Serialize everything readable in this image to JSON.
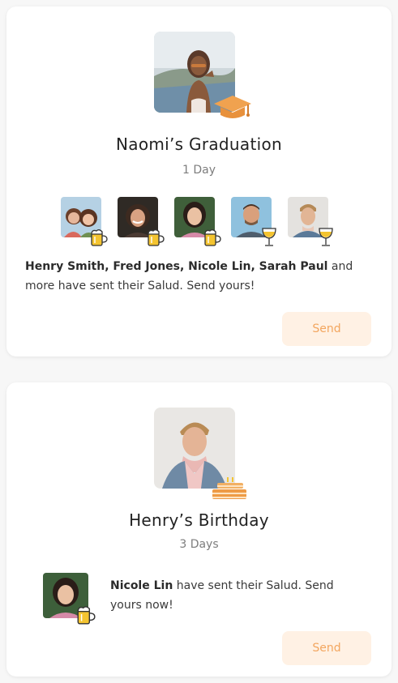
{
  "events": [
    {
      "title": "Naomi’s Graduation",
      "time": "1 Day",
      "hero_badge_icon": "graduation-cap-icon",
      "senders": [
        {
          "drink_icon": "beer-mug-icon"
        },
        {
          "drink_icon": "beer-mug-icon"
        },
        {
          "drink_icon": "beer-mug-icon"
        },
        {
          "drink_icon": "wine-glass-icon"
        },
        {
          "drink_icon": "wine-glass-icon"
        }
      ],
      "message_names": "Henry Smith, Fred Jones, Nicole Lin, Sarah Paul",
      "message_rest": " and more have sent their Salud. Send yours!",
      "send_label": "Send"
    },
    {
      "title": "Henry’s Birthday",
      "time": "3 Days",
      "hero_badge_icon": "birthday-cake-icon",
      "sender_drink_icon": "beer-mug-icon",
      "message_names": "Nicole Lin",
      "message_rest": " have sent their Salud. Send yours now!",
      "send_label": "Send"
    }
  ],
  "colors": {
    "accent": "#f3a65f",
    "send_bg": "#fff1e4",
    "badge_orange": "#f0a24f",
    "beer_yellow": "#f4c430"
  }
}
